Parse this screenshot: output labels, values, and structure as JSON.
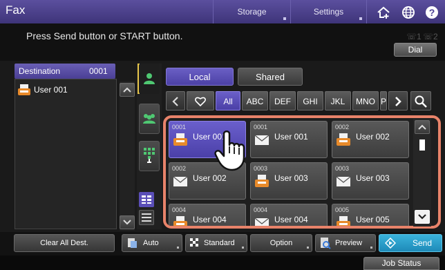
{
  "header": {
    "title": "Fax",
    "tabs": [
      {
        "label": "Storage"
      },
      {
        "label": "Settings"
      }
    ],
    "icons": [
      "home-plus-icon",
      "globe-icon",
      "help-icon"
    ]
  },
  "message": {
    "text": "Press Send button or START button.",
    "line1": "1",
    "line2": "2",
    "dial_label": "Dial"
  },
  "destination": {
    "label": "Destination",
    "count": "0001",
    "items": [
      {
        "name": "User 001",
        "icon": "fax-icon"
      }
    ]
  },
  "address_book": {
    "tabs": {
      "local": "Local",
      "shared": "Shared"
    },
    "index": [
      "All",
      "ABC",
      "DEF",
      "GHI",
      "JKL",
      "MNO",
      "P"
    ],
    "selected_index": "All",
    "cards": [
      {
        "num": "0001",
        "name": "User 001",
        "icon": "fax-icon",
        "selected": true
      },
      {
        "num": "0001",
        "name": "User 001",
        "icon": "mail-icon",
        "selected": false
      },
      {
        "num": "0002",
        "name": "User 002",
        "icon": "fax-icon",
        "selected": false
      },
      {
        "num": "0002",
        "name": "User 002",
        "icon": "mail-icon",
        "selected": false
      },
      {
        "num": "0003",
        "name": "User 003",
        "icon": "fax-icon",
        "selected": false
      },
      {
        "num": "0003",
        "name": "User 003",
        "icon": "mail-icon",
        "selected": false
      },
      {
        "num": "0004",
        "name": "User 004",
        "icon": "fax-icon",
        "selected": false
      },
      {
        "num": "0004",
        "name": "User 004",
        "icon": "mail-icon",
        "selected": false
      },
      {
        "num": "0005",
        "name": "User 005",
        "icon": "fax-icon",
        "selected": false
      }
    ]
  },
  "toolbar": {
    "clear_label": "Clear All Dest.",
    "auto_label": "Auto",
    "standard_label": "Standard",
    "option_label": "Option",
    "preview_label": "Preview",
    "send_label": "Send"
  },
  "status": {
    "job_status_label": "Job Status"
  },
  "colors": {
    "accent": "#5b4f9e",
    "highlight": "#e8836a",
    "send": "#2a9fcc",
    "index_active": "#e8c74a"
  }
}
